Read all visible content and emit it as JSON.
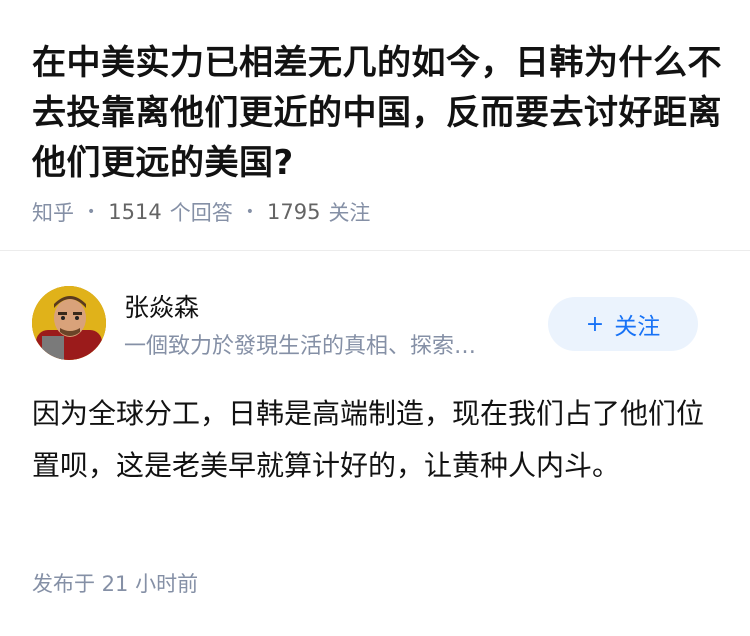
{
  "question": {
    "title": "在中美实力已相差无几的如今，日韩为什么不去投靠离他们更近的中国，反而要去讨好距离他们更远的美国?",
    "source": "知乎",
    "answer_count": "1514",
    "answer_label": "个回答",
    "follow_count": "1795",
    "follow_label": "关注"
  },
  "answer": {
    "author_name": "张焱森",
    "author_bio": "一個致力於發現生活的真相、探索…",
    "follow_button": "关注",
    "follow_plus": "+",
    "content": "因为全球分工，日韩是高端制造，现在我们占了他们位置呗，这是老美早就算计好的，让黄种人内斗。",
    "publish_time": "发布于 21 小时前"
  }
}
